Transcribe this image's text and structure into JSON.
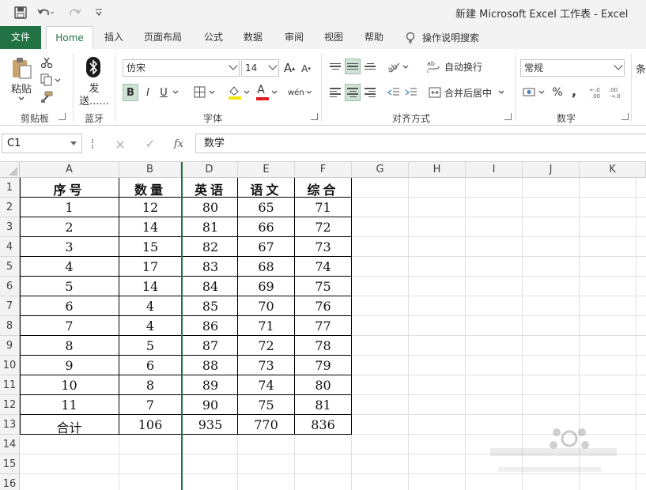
{
  "window": {
    "title": "新建 Microsoft Excel 工作表 - Excel"
  },
  "tabs": [
    {
      "label": "文件"
    },
    {
      "label": "Home"
    },
    {
      "label": "插入"
    },
    {
      "label": "页面布局"
    },
    {
      "label": "公式"
    },
    {
      "label": "数据"
    },
    {
      "label": "审阅"
    },
    {
      "label": "视图"
    },
    {
      "label": "帮助"
    }
  ],
  "search": {
    "label": "操作说明搜索"
  },
  "ribbon": {
    "clipboard": {
      "paste": "粘贴",
      "label": "剪贴板"
    },
    "bluetooth": {
      "send_line1": "发",
      "send_line2": "送......",
      "label": "蓝牙"
    },
    "font": {
      "name": "仿宋",
      "size": "14",
      "label": "字体",
      "grow": "A",
      "shrink": "A",
      "bold": "B",
      "italic": "I",
      "underline": "U",
      "color_a": "A",
      "phonetic": "wén"
    },
    "alignment": {
      "wrap": "自动换行",
      "merge": "合并后居中",
      "label": "对齐方式"
    },
    "number": {
      "format": "常规",
      "percent": "%",
      "comma": ",",
      "label": "数字"
    },
    "next_group_char": "条"
  },
  "formula_bar": {
    "name_box": "C1",
    "cancel": "×",
    "enter": "✓",
    "fx": "fx",
    "content": "数学"
  },
  "sheet": {
    "columns": [
      "A",
      "B",
      "D",
      "E",
      "F",
      "G",
      "H",
      "I",
      "J",
      "K"
    ],
    "rows": [
      "1",
      "2",
      "3",
      "4",
      "5",
      "6",
      "7",
      "8",
      "9",
      "10",
      "11",
      "12",
      "13",
      "14",
      "15",
      "16"
    ],
    "header": [
      "序号",
      "数量",
      "英语",
      "语文",
      "综合"
    ],
    "data": [
      [
        "1",
        "12",
        "80",
        "65",
        "71"
      ],
      [
        "2",
        "14",
        "81",
        "66",
        "72"
      ],
      [
        "3",
        "15",
        "82",
        "67",
        "73"
      ],
      [
        "4",
        "17",
        "83",
        "68",
        "74"
      ],
      [
        "5",
        "14",
        "84",
        "69",
        "75"
      ],
      [
        "6",
        "4",
        "85",
        "70",
        "76"
      ],
      [
        "7",
        "4",
        "86",
        "71",
        "77"
      ],
      [
        "8",
        "5",
        "87",
        "72",
        "78"
      ],
      [
        "9",
        "6",
        "88",
        "73",
        "79"
      ],
      [
        "10",
        "8",
        "89",
        "74",
        "80"
      ],
      [
        "11",
        "7",
        "90",
        "75",
        "81"
      ],
      [
        "合计",
        "106",
        "935",
        "770",
        "836"
      ]
    ]
  },
  "colors": {
    "excel_green": "#217346"
  }
}
